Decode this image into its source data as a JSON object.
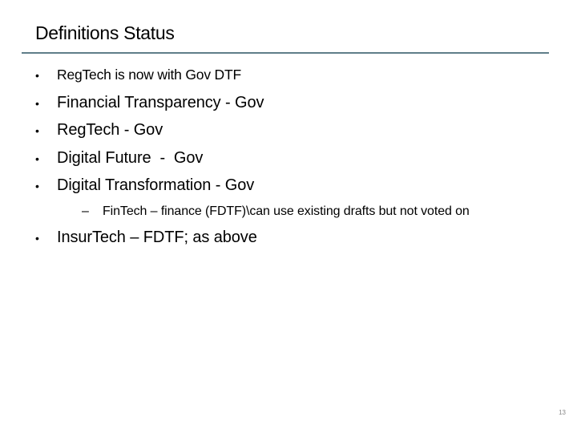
{
  "slide": {
    "title": "Definitions Status",
    "bullets": [
      {
        "text": "RegTech is now with Gov DTF"
      },
      {
        "text": "Financial Transparency - Gov"
      },
      {
        "text": "RegTech - Gov"
      },
      {
        "text": "Digital Future  -  Gov"
      },
      {
        "text": "Digital Transformation - Gov"
      }
    ],
    "sub_bullet": {
      "marker": "–",
      "text": "FinTech – finance (FDTF)\\can use existing drafts but not voted on"
    },
    "last_bullet": {
      "text": "InsurTech – FDTF; as above"
    },
    "bullet_marker": "•",
    "page_number": "13",
    "colors": {
      "rule": "#607e89"
    }
  }
}
